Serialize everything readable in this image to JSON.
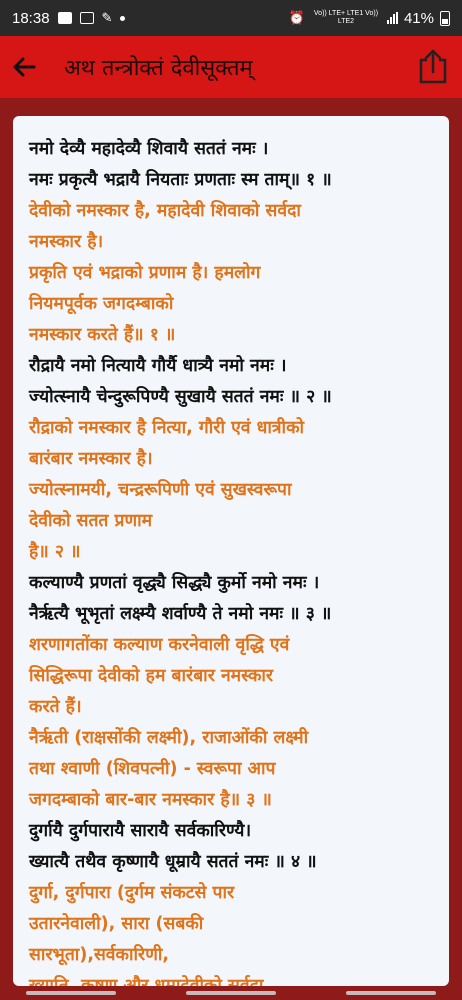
{
  "status_bar": {
    "time": "18:38",
    "network_label": "Vo)) LTE+ LTE1 Vo)) LTE2",
    "battery": "41%"
  },
  "app_bar": {
    "title": "अथ तन्त्रोक्तं देवीसूक्तम्",
    "back_icon": "arrow-left-icon",
    "share_icon": "share-icon"
  },
  "verses": [
    {
      "text": "नमो देव्यै महादेव्यै शिवायै सततं नमः ।",
      "type": "sanskrit"
    },
    {
      "text": "नमः प्रकृत्यै भद्रायै नियताः प्रणताः स्म ताम्॥ १ ॥",
      "type": "sanskrit"
    },
    {
      "text": "देवीको नमस्कार है, महादेवी शिवाको सर्वदा",
      "type": "hindi"
    },
    {
      "text": "नमस्कार है।",
      "type": "hindi"
    },
    {
      "text": "प्रकृति एवं भद्राको प्रणाम है। हमलोग",
      "type": "hindi"
    },
    {
      "text": " नियमपूर्वक जगदम्बाको",
      "type": "hindi"
    },
    {
      "text": "नमस्कार करते हैं॥ १ ॥",
      "type": "hindi"
    },
    {
      "text": "रौद्रायै नमो नित्यायै गौर्यै धात्र्यै नमो नमः ।",
      "type": "sanskrit"
    },
    {
      "text": "ज्योत्स्नायै चेन्दुरूपिण्यै सुखायै सततं नमः ॥ २ ॥",
      "type": "sanskrit"
    },
    {
      "text": "रौद्राको नमस्कार है नित्या, गौरी एवं धात्रीको",
      "type": "hindi"
    },
    {
      "text": " बारंबार नमस्कार है।",
      "type": "hindi"
    },
    {
      "text": "ज्योत्स्नामयी, चन्द्ररूपिणी एवं सुखस्वरूपा",
      "type": "hindi"
    },
    {
      "text": " देवीको सतत प्रणाम",
      "type": "hindi"
    },
    {
      "text": "है॥ २ ॥",
      "type": "hindi"
    },
    {
      "text": "कल्याण्यै प्रणतां वृद्ध्यै सिद्ध्यै कुर्मो नमो नमः ।",
      "type": "sanskrit"
    },
    {
      "text": "नैर्ऋत्यै भूभृतां लक्ष्म्यै शर्वाण्यै ते नमो नमः ॥ ३ ॥",
      "type": "sanskrit"
    },
    {
      "text": "शरणागतोंका कल्याण करनेवाली वृद्धि एवं",
      "type": "hindi"
    },
    {
      "text": " सिद्धिरूपा देवीको हम बारंबार नमस्कार",
      "type": "hindi"
    },
    {
      "text": " करते हैं।",
      "type": "hindi"
    },
    {
      "text": "नैर्ऋती (राक्षसोंकी लक्ष्मी), राजाओंकी लक्ष्मी",
      "type": "hindi"
    },
    {
      "text": "तथा श्वाणी (शिवपत्नी) - स्वरूपा आप",
      "type": "hindi"
    },
    {
      "text": " जगदम्बाको बार-बार नमस्कार है॥ ३ ॥",
      "type": "hindi"
    },
    {
      "text": "दुर्गायै दुर्गपारायै सारायै सर्वकारिण्यै।",
      "type": "sanskrit"
    },
    {
      "text": "ख्यात्यै तथैव कृष्णायै धूम्रायै सततं नमः ॥ ४ ॥",
      "type": "sanskrit"
    },
    {
      "text": "दुर्गा, दुर्गपारा (दुर्गम संकटसे पार",
      "type": "hindi"
    },
    {
      "text": " उतारनेवाली), सारा (सबकी",
      "type": "hindi"
    },
    {
      "text": " सारभूता),सर्वकारिणी,",
      "type": "hindi"
    },
    {
      "text": "ख्याति, कृष्णा और धूम्रादेवीको सर्वदा",
      "type": "hindi"
    }
  ],
  "colors": {
    "app_bar": "#d61515",
    "background": "#8f1a1a",
    "card": "#f3f6fb",
    "sanskrit_text": "#111111",
    "hindi_text": "#e0741a"
  }
}
